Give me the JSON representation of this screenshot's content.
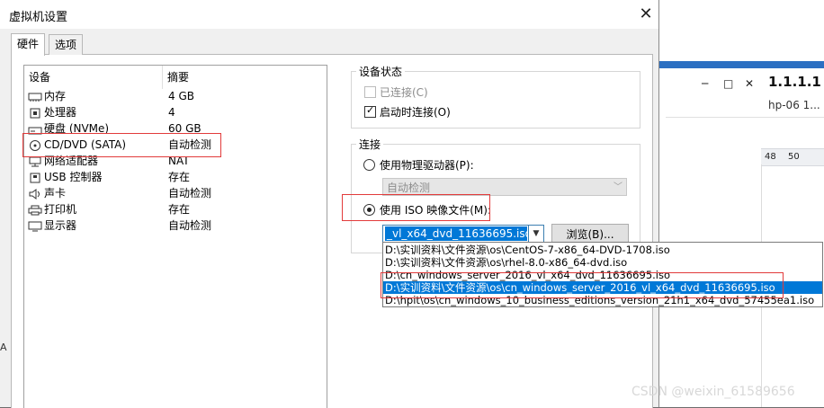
{
  "dialog": {
    "title": "虚拟机设置",
    "close_label": "✕",
    "tabs": [
      {
        "label": "硬件",
        "active": true
      },
      {
        "label": "选项",
        "active": false
      }
    ]
  },
  "device_list": {
    "columns": {
      "device": "设备",
      "summary": "摘要"
    },
    "rows": [
      {
        "name": "内存",
        "summary": "4 GB",
        "icon": "memory-icon"
      },
      {
        "name": "处理器",
        "summary": "4",
        "icon": "cpu-icon"
      },
      {
        "name": "硬盘 (NVMe)",
        "summary": "60 GB",
        "icon": "hard-disk-icon"
      },
      {
        "name": "CD/DVD (SATA)",
        "summary": "自动检测",
        "icon": "cd-dvd-icon"
      },
      {
        "name": "网络适配器",
        "summary": "NAT",
        "icon": "network-adapter-icon"
      },
      {
        "name": "USB 控制器",
        "summary": "存在",
        "icon": "usb-icon"
      },
      {
        "name": "声卡",
        "summary": "自动检测",
        "icon": "speaker-icon"
      },
      {
        "name": "打印机",
        "summary": "存在",
        "icon": "printer-icon"
      },
      {
        "name": "显示器",
        "summary": "自动检测",
        "icon": "monitor-icon"
      }
    ]
  },
  "device_status": {
    "group_label": "设备状态",
    "connected_label": "已连接(C)",
    "connected_checked": false,
    "connect_on_power_label": "启动时连接(O)",
    "connect_on_power_checked": true
  },
  "connection": {
    "group_label": "连接",
    "physical_drive_label": "使用物理驱动器(P):",
    "physical_drive_value": "自动检测",
    "iso_label": "使用 ISO 映像文件(M):",
    "iso_selected": true,
    "iso_value": "_vl_x64_dvd_11636695.iso",
    "browse_label": "浏览(B)...",
    "iso_options": [
      "D:\\实训资料\\文件资源\\os\\CentOS-7-x86_64-DVD-1708.iso",
      "D:\\实训资料\\文件资源\\os\\rhel-8.0-x86_64-dvd.iso",
      "D:\\cn_windows_server_2016_vl_x64_dvd_11636695.iso",
      "D:\\实训资料\\文件资源\\os\\cn_windows_server_2016_vl_x64_dvd_11636695.iso",
      "D:\\hpit\\os\\cn_windows_10_business_editions_version_21h1_x64_dvd_57455ea1.iso"
    ],
    "iso_selected_index": 3
  },
  "background_window": {
    "title": "1.1.1.1",
    "subtitle": "hp-06 1...",
    "col_48": "48",
    "col_50": "50",
    "min_icon": "─",
    "max_icon": "□",
    "close_icon": "✕"
  },
  "watermark": "CSDN @weixin_61589656",
  "edge_text": "A",
  "colors": {
    "selection_blue": "#0078d7",
    "annotation_red": "#e23b3b"
  }
}
